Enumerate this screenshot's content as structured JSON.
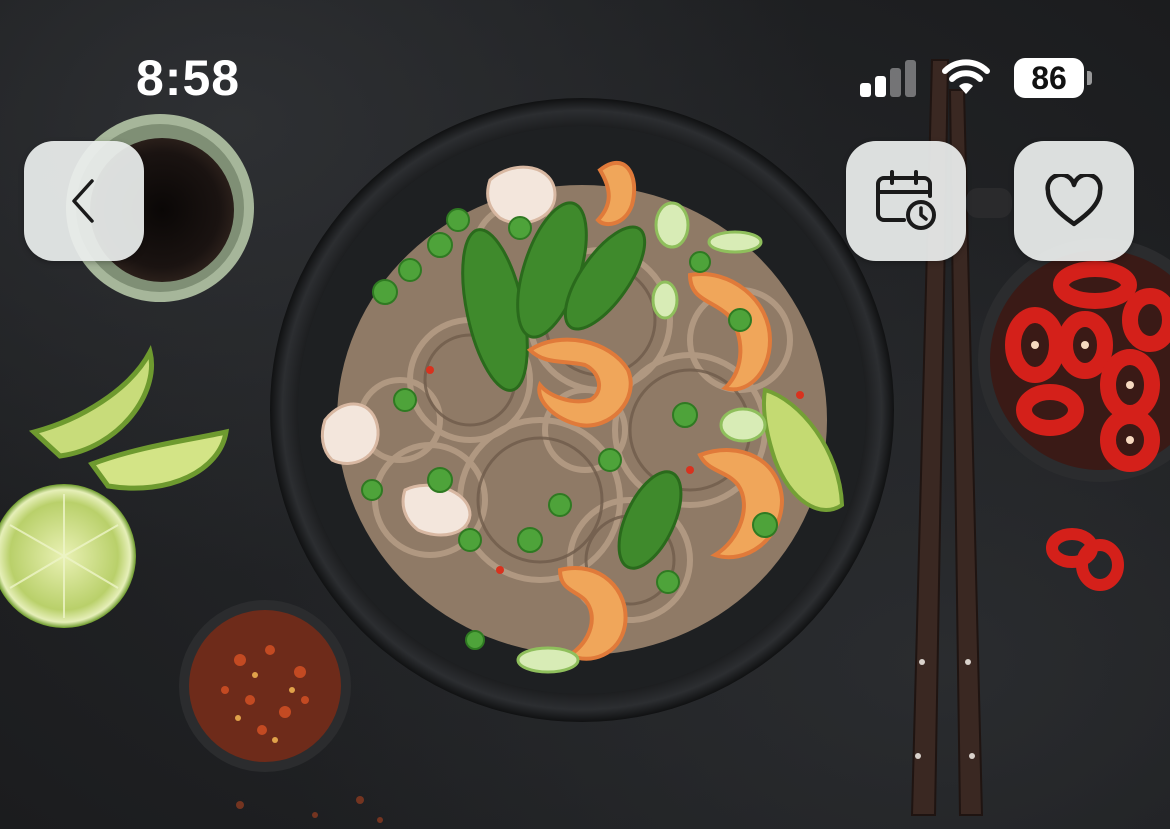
{
  "status_bar": {
    "time": "8:58",
    "battery_level": "86",
    "battery_fraction": 0.86,
    "signal_bars_active": 2,
    "signal_bars_total": 4
  },
  "header": {
    "back_icon": "chevron-left-icon",
    "schedule_icon": "calendar-clock-icon",
    "favorite_icon": "heart-outline-icon"
  },
  "colors": {
    "button_bg": "#EBEEED",
    "icon": "#1A1A1A",
    "status_text": "#FFFFFF"
  }
}
